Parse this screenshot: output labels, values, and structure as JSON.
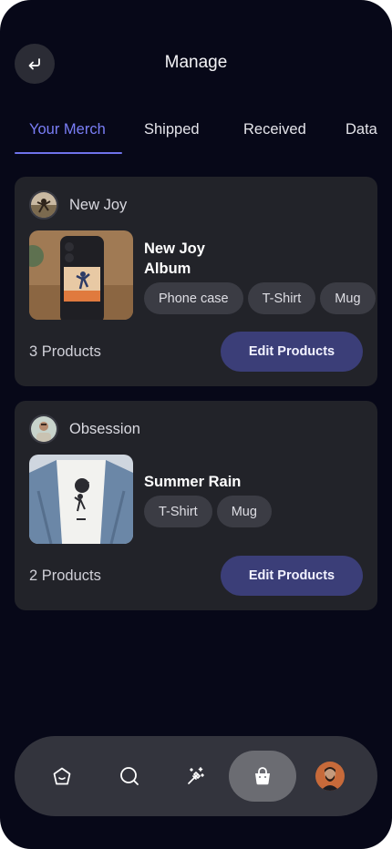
{
  "header": {
    "title": "Manage",
    "back_icon": "back-arrow-icon"
  },
  "tabs": [
    {
      "label": "Your Merch",
      "active": true
    },
    {
      "label": "Shipped",
      "active": false
    },
    {
      "label": "Received",
      "active": false
    },
    {
      "label": "Data",
      "active": false
    }
  ],
  "cards": [
    {
      "artist": "New Joy",
      "product_title": "New Joy Album",
      "chips": [
        "Phone case",
        "T-Shirt",
        "Mug"
      ],
      "count": "3 Products",
      "button": "Edit Products"
    },
    {
      "artist": "Obsession",
      "product_title": "Summer Rain",
      "chips": [
        "T-Shirt",
        "Mug"
      ],
      "count": "2 Products",
      "button": "Edit Products"
    }
  ],
  "nav": {
    "items": [
      "home-icon",
      "search-icon",
      "magic-wand-icon",
      "shopping-bag-icon",
      "profile-avatar"
    ],
    "active": "shopping-bag-icon"
  },
  "colors": {
    "background": "#070818",
    "card": "#222329",
    "accent": "#7a7ef6",
    "button": "#3b3e78",
    "chip": "#3b3c44"
  }
}
